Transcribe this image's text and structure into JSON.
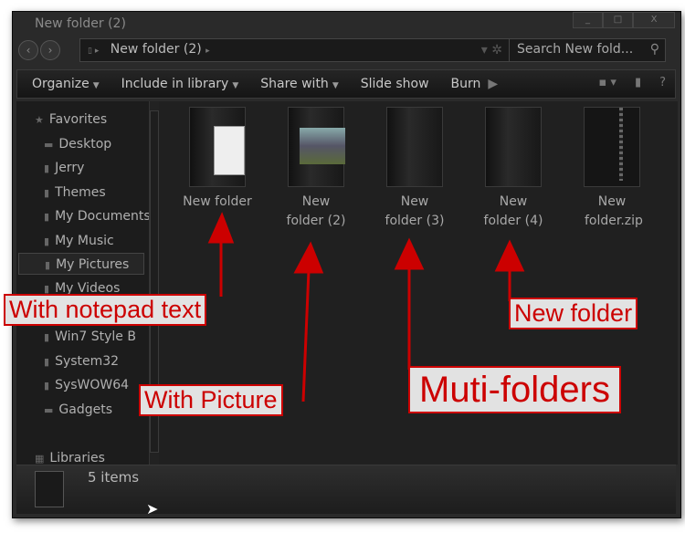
{
  "window": {
    "title": "New folder (2)",
    "controls": [
      "_",
      "□",
      "X"
    ]
  },
  "address": {
    "crumb": "New folder (2)",
    "search_placeholder": "Search New fold..."
  },
  "toolbar": {
    "organize": "Organize",
    "include": "Include in library",
    "share": "Share with",
    "slideshow": "Slide show",
    "burn": "Burn"
  },
  "sidebar": {
    "favorites": "Favorites",
    "items": [
      "Desktop",
      "Jerry",
      "Themes",
      "My Documents",
      "My Music",
      "My Pictures",
      "My Videos",
      "Win7 Style B",
      "System32",
      "SysWOW64",
      "Gadgets"
    ],
    "libraries": "Libraries",
    "selected": "My Pictures"
  },
  "files": [
    {
      "name": "New folder",
      "type": "folder-doc"
    },
    {
      "name": "New folder (2)",
      "type": "folder-picture"
    },
    {
      "name": "New folder (3)",
      "type": "folder"
    },
    {
      "name": "New folder (4)",
      "type": "folder"
    },
    {
      "name": "New folder.zip",
      "type": "zip"
    }
  ],
  "status": {
    "count": "5 items"
  },
  "annotations": {
    "notepad": "With notepad text",
    "picture": "With Picture",
    "multi": "Muti-folders",
    "newfolder": "New folder",
    "color": "#cc0000"
  }
}
